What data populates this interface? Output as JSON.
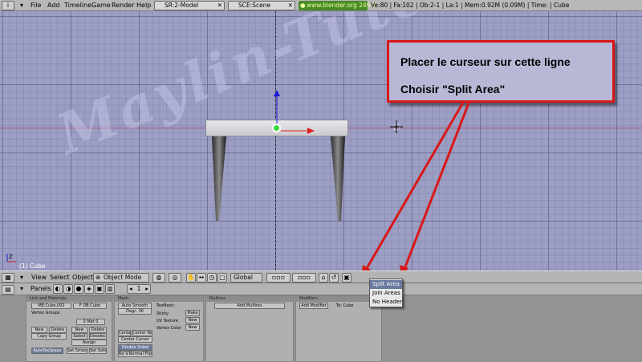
{
  "header": {
    "menus": [
      "File",
      "Add",
      "Timeline",
      "Game",
      "Render",
      "Help"
    ],
    "screen_field": "SR:2-Model",
    "scene_field": "SCE:Scene",
    "url": "www.blender.org 249.2",
    "stats": "Ve:80 | Fa:102 | Ob:2-1 | La:1 | Mem:0.92M (0.09M) | Time: | Cube"
  },
  "viewport": {
    "watermark": "Maylin-Tuto",
    "axis_label": "Z",
    "object_label": "(1) Cube"
  },
  "callout": {
    "line1": "Placer le curseur sur cette ligne",
    "line2": "Choisir \"Split Area\""
  },
  "view3d_header": {
    "menus": [
      "View",
      "Select",
      "Object"
    ],
    "mode": "Object Mode",
    "orientation": "Global"
  },
  "popup": {
    "items": [
      "Split Area",
      "Join Areas",
      "No Header"
    ],
    "selected": "Split Area"
  },
  "buttons_header": {
    "panels_label": "Panels",
    "frame_value": "1"
  },
  "buttons_window": {
    "link_panel": {
      "title": "Link and Materials",
      "me_field": "ME:Cube.002",
      "ob_field": "F OB:Cube",
      "vertex_groups": "Vertex Groups",
      "mat_field": "0 Mat 0",
      "new": "New",
      "delete": "Delete",
      "copy_group": "Copy Group",
      "select": "Select",
      "deselect": "Deselect",
      "assign": "Assign",
      "new2": "New",
      "delete2": "Delete",
      "auto_tex_space": "AutoTexSpace",
      "set_smooth": "Set Smooth",
      "set_solid": "Set Solid"
    },
    "mesh_panel": {
      "title": "Mesh",
      "auto_smooth": "Auto Smooth",
      "degr": "Degr: 30",
      "tex_mesh": "TexMesh:",
      "sticky": "Sticky",
      "make": "Make",
      "uv_texture": "UV Texture",
      "new_uv": "New",
      "vertex_color": "Vertex Color",
      "new_vc": "New",
      "center": "Center",
      "center_new": "Center New",
      "center_cursor": "Center Cursor",
      "double_sided": "Double Sided",
      "no_vnormal_flip": "No V.Normal Flip"
    },
    "multires_panel": {
      "title": "Multires",
      "add_multires": "Add Multires"
    },
    "modifiers_panel": {
      "title": "Modifiers",
      "add_modifier": "Add Modifier",
      "to": "To: Cube"
    }
  },
  "colors": {
    "viewport_bg": "#9c9ec4",
    "annotation_red": "#d81818",
    "url_green": "#4a8a2a"
  }
}
